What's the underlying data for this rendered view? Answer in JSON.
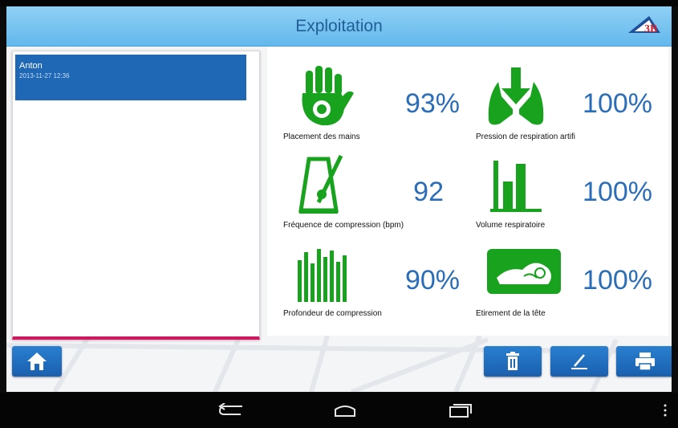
{
  "app": {
    "title": "Exploitation",
    "logo_text": "3B"
  },
  "session_list": {
    "items": [
      {
        "name": "Anton",
        "date": "2013-11-27 12:36",
        "selected": true
      }
    ]
  },
  "metrics": [
    {
      "id": "hand-placement",
      "label": "Placement des mains",
      "value": "93%",
      "icon": "hand-icon"
    },
    {
      "id": "ventilation-pressure",
      "label": "Pression de respiration artifi",
      "value": "100%",
      "icon": "lungs-icon"
    },
    {
      "id": "compression-rate",
      "label": "Fréquence de compression (bpm)",
      "value": "92",
      "icon": "metronome-icon"
    },
    {
      "id": "respiratory-volume",
      "label": "Volume respiratoire",
      "value": "100%",
      "icon": "volume-bars-icon"
    },
    {
      "id": "compression-depth",
      "label": "Profondeur de compression",
      "value": "90%",
      "icon": "depth-bars-icon"
    },
    {
      "id": "head-tilt",
      "label": "Etirement de la tête",
      "value": "100%",
      "icon": "head-tilt-icon"
    }
  ],
  "toolbar": {
    "home": "home-icon",
    "delete": "trash-icon",
    "edit": "pencil-icon",
    "print": "printer-icon"
  },
  "system_nav": {
    "back": "back-icon",
    "home": "home-nav-icon",
    "recents": "recents-icon",
    "menu": "overflow-menu-icon"
  },
  "colors": {
    "titlebar": "#6dbdee",
    "accent_blue": "#1f68b6",
    "metric_green": "#19a21e",
    "value_blue": "#2a6db8",
    "list_underline": "#e0105e"
  }
}
